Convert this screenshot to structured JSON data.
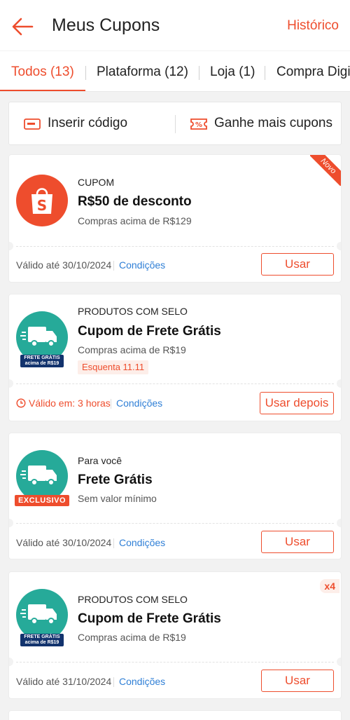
{
  "header": {
    "title": "Meus Cupons",
    "history_label": "Histórico"
  },
  "tabs": [
    {
      "label": "Todos (13)",
      "active": true
    },
    {
      "label": "Plataforma (12)"
    },
    {
      "label": "Loja (1)"
    },
    {
      "label": "Compra Digit"
    }
  ],
  "actions": {
    "insert_code": "Inserir código",
    "earn_more": "Ganhe mais cupons"
  },
  "coupons": [
    {
      "category": "CUPOM",
      "title": "R$50 de desconto",
      "condition": "Compras acima de R$129",
      "validity": "Válido até 30/10/2024",
      "conditions_link": "Condições",
      "button": "Usar",
      "ribbon": "Novo",
      "logo": "shopee-bag-icon"
    },
    {
      "category": "PRODUTOS COM SELO",
      "title": "Cupom de Frete Grátis",
      "condition": "Compras acima de R$19",
      "tag": "Esquenta 11.11",
      "validity": "Válido em: 3 horas",
      "conditions_link": "Condições",
      "button": "Usar depois",
      "logo_label": "FRETE GRÁTIS acima de R$19",
      "logo": "truck-icon"
    },
    {
      "category": "Para você",
      "title": "Frete Grátis",
      "condition": "Sem valor mínimo",
      "validity": "Válido até 30/10/2024",
      "conditions_link": "Condições",
      "button": "Usar",
      "logo_label": "EXCLUSIVO",
      "logo": "truck-icon"
    },
    {
      "category": "PRODUTOS COM SELO",
      "title": "Cupom de Frete Grátis",
      "condition": "Compras acima de R$19",
      "validity": "Válido até 31/10/2024",
      "conditions_link": "Condições",
      "button": "Usar",
      "badge": "x4",
      "logo_label": "FRETE GRÁTIS acima de R$19",
      "logo": "truck-icon"
    }
  ],
  "colors": {
    "accent": "#ee4d2d",
    "teal": "#26aa99",
    "link": "#2f7fd6",
    "navy": "#12336d"
  }
}
